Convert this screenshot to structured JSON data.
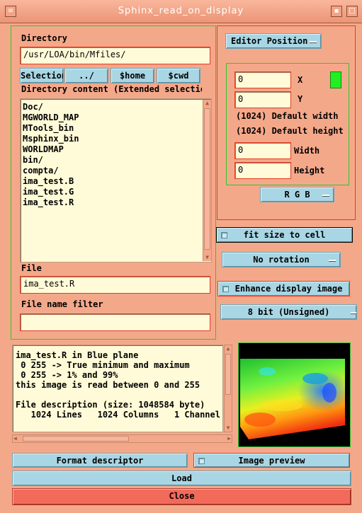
{
  "window": {
    "title": "Sphinx_read_on_display",
    "menu_glyph": "≡",
    "minimize_glyph": "▪",
    "maximize_glyph": "□"
  },
  "directory": {
    "label": "Directory",
    "value": "/usr/LOA/bin/Mfiles/",
    "buttons": {
      "selection": "Selection",
      "up": "../",
      "home": "$home",
      "cwd": "$cwd"
    },
    "content_label": "Directory content (Extended selection)",
    "items": [
      "Doc/",
      "MGWORLD_MAP",
      "MTools_bin",
      "Msphinx_bin",
      "WORLDMAP",
      "bin/",
      "compta/",
      "ima_test.B",
      "ima_test.G",
      "ima_test.R"
    ]
  },
  "file": {
    "label": "File",
    "value": "ima_test.R"
  },
  "filter": {
    "label": "File name filter",
    "value": ""
  },
  "editor": {
    "position_label": "Editor Position",
    "x_value": "0",
    "x_label": "X",
    "y_value": "0",
    "y_label": "Y",
    "default_width": "(1024) Default width",
    "default_height": "(1024) Default height",
    "width_value": "0",
    "width_label": "Width",
    "height_value": "0",
    "height_label": "Height",
    "indicator_color": "#22ee22",
    "color_mode": "R G B"
  },
  "options": {
    "fit_size": "fit size to cell",
    "rotation": "No rotation",
    "enhance": "Enhance display image",
    "bit_depth": "8 bit (Unsigned)"
  },
  "info": {
    "lines": [
      "ima_test.R in Blue plane",
      " 0 255 -> True minimum and maximum",
      " 0 255 -> 1% and 99%",
      "this image is read between 0 and 255",
      "",
      "File description (size: 1048584 byte)",
      "   1024 Lines   1024 Columns   1 Channel"
    ]
  },
  "buttons": {
    "format_descriptor": "Format descriptor",
    "image_preview": "Image preview",
    "load": "Load",
    "close": "Close"
  },
  "colors": {
    "background": "#f4a88a",
    "button": "#a8d6e4",
    "close": "#f26a5a",
    "frame_green": "#2ec72e",
    "frame_red": "#e53a22"
  }
}
